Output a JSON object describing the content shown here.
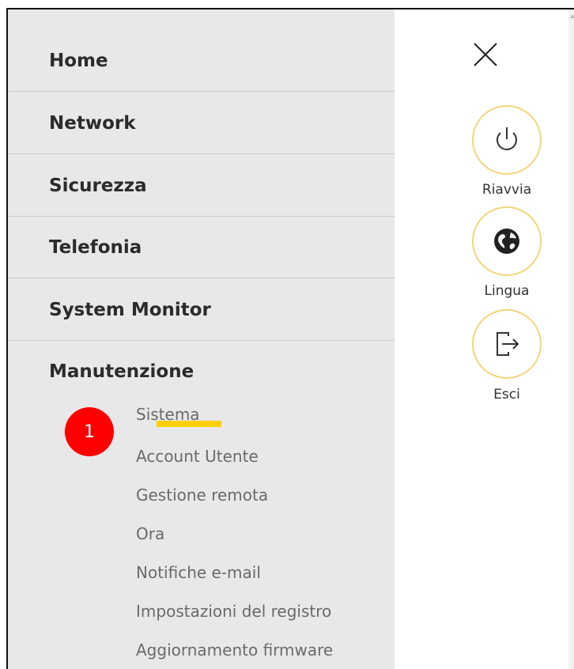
{
  "menu": {
    "items": [
      {
        "label": "Home"
      },
      {
        "label": "Network"
      },
      {
        "label": "Sicurezza"
      },
      {
        "label": "Telefonia"
      },
      {
        "label": "System Monitor"
      },
      {
        "label": "Manutenzione"
      }
    ],
    "submenu": [
      {
        "label": "Sistema"
      },
      {
        "label": "Account Utente"
      },
      {
        "label": "Gestione remota"
      },
      {
        "label": "Ora"
      },
      {
        "label": "Notifiche e-mail"
      },
      {
        "label": "Impostazioni del registro"
      },
      {
        "label": "Aggiornamento firmware"
      }
    ]
  },
  "annotation": {
    "step": "1",
    "color": "#ff0000",
    "highlight_color": "#ffd000"
  },
  "panel": {
    "close_icon": "close-icon",
    "actions": [
      {
        "label": "Riavvia",
        "icon": "power-icon"
      },
      {
        "label": "Lingua",
        "icon": "globe-icon"
      },
      {
        "label": "Esci",
        "icon": "logout-icon"
      }
    ],
    "accent_color": "#f3d67a"
  }
}
